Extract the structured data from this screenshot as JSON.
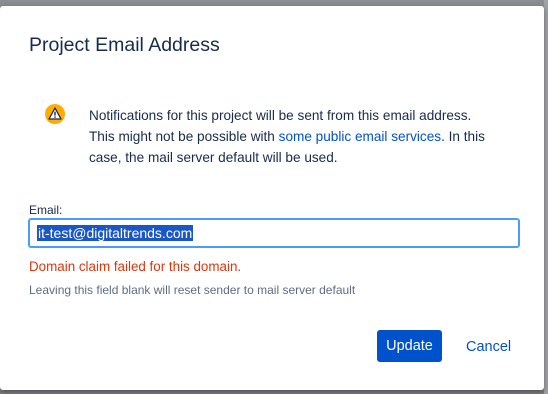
{
  "dialog": {
    "title": "Project Email Address",
    "warning_icon": "warning-icon",
    "message_part1": "Notifications for this project will be sent from this email address. This might not be possible with ",
    "message_link": "some public email services",
    "message_part2": ". In this case, the mail server default will be used.",
    "email_label": "Email:",
    "email_value": "it-test@digitaltrends.com",
    "error_text": "Domain claim failed for this domain.",
    "hint_text": "Leaving this field blank will reset sender to mail server default",
    "update_label": "Update",
    "cancel_label": "Cancel"
  },
  "colors": {
    "primary": "#0052cc",
    "error": "#de350b",
    "warning": "#ffab00",
    "text": "#172b4d",
    "hint": "#5e6c84"
  }
}
